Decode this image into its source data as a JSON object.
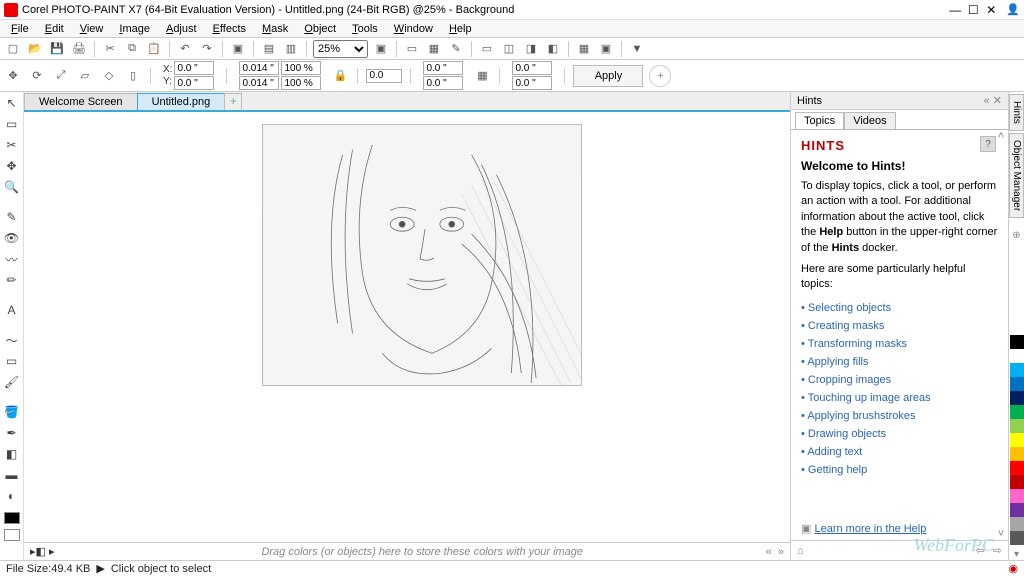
{
  "titlebar": {
    "title": "Corel PHOTO-PAINT X7 (64-Bit Evaluation Version) - Untitled.png (24-Bit RGB) @25% - Background"
  },
  "menu": [
    "File",
    "Edit",
    "View",
    "Image",
    "Adjust",
    "Effects",
    "Mask",
    "Object",
    "Tools",
    "Window",
    "Help"
  ],
  "toolbar": {
    "new": "new",
    "open": "open",
    "save": "save",
    "print": "print",
    "cut": "cut",
    "copy": "copy",
    "paste": "paste",
    "undo": "undo",
    "redo": "redo",
    "zoom_value": "25%"
  },
  "props": {
    "x_label": "X:",
    "y_label": "Y:",
    "x": "0.0 \"",
    "y": "0.0 \"",
    "w": "0.014 \"",
    "h": "0.014 \"",
    "pct1": "100 %",
    "pct2": "100 %",
    "rot": "0.0",
    "a1": "0.0 \"",
    "a2": "0.0 \"",
    "b1": "0.0 \"",
    "b2": "0.0 \"",
    "apply": "Apply"
  },
  "tabs": {
    "welcome": "Welcome Screen",
    "file": "Untitled.png"
  },
  "tray_hint": "Drag colors (or objects) here to store these colors with your image",
  "hints": {
    "panel_title": "Hints",
    "tab_topics": "Topics",
    "tab_videos": "Videos",
    "heading": "HINTS",
    "subheading": "Welcome to Hints!",
    "p1": "To display topics, click a tool, or perform an action with a tool. For additional information about the active tool, click the ",
    "p1b": "Help",
    "p1c": " button in the upper-right corner of the ",
    "p1d": "Hints",
    "p1e": " docker.",
    "p2": "Here are some particularly helpful topics:",
    "links": [
      "Selecting objects",
      "Creating masks",
      "Transforming masks",
      "Applying fills",
      "Cropping images",
      "Touching up image areas",
      "Applying brushstrokes",
      "Drawing objects",
      "Adding text",
      "Getting help"
    ],
    "learn_more": "Learn more in the Help"
  },
  "right_tabs": [
    "Hints",
    "Object Manager"
  ],
  "palette": [
    "#000000",
    "#ffffff",
    "#00b0f0",
    "#0070c0",
    "#002060",
    "#00b050",
    "#92d050",
    "#ffff00",
    "#ffc000",
    "#ff0000",
    "#c00000",
    "#ff66cc",
    "#7030a0",
    "#a6a6a6",
    "#595959"
  ],
  "status": {
    "size_label": "File Size: ",
    "size": "49.4 KB",
    "hint": "Click object to select"
  },
  "watermark": "WebForPC"
}
